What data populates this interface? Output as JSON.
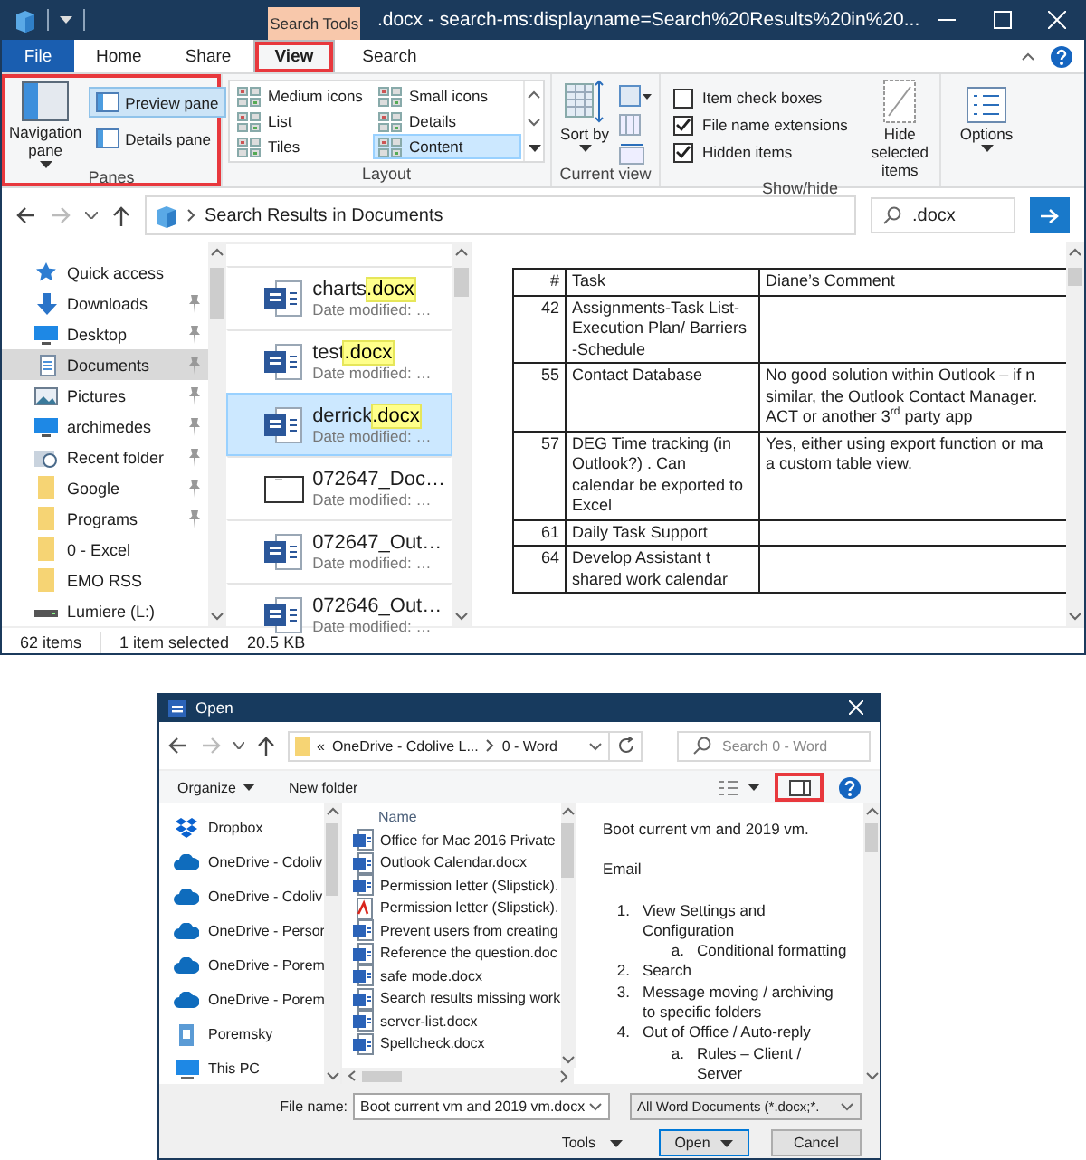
{
  "explorer": {
    "title": ".docx - search-ms:displayname=Search%20Results%20in%20...",
    "context_tab": "Search Tools",
    "tabs": [
      {
        "label": "File",
        "kind": "file",
        "selected": false,
        "highlighted": false
      },
      {
        "label": "Home",
        "kind": "plain",
        "selected": false,
        "highlighted": false
      },
      {
        "label": "Share",
        "kind": "plain",
        "selected": false,
        "highlighted": false
      },
      {
        "label": "View",
        "kind": "plain",
        "selected": true,
        "highlighted": true
      },
      {
        "label": "Search",
        "kind": "context",
        "selected": false,
        "highlighted": false
      }
    ],
    "ribbon": {
      "panes": {
        "label": "Panes",
        "highlighted": true,
        "navigation_pane": "Navigation pane",
        "buttons": [
          {
            "label": "Preview pane",
            "selected": true
          },
          {
            "label": "Details pane",
            "selected": false
          }
        ]
      },
      "layout": {
        "label": "Layout",
        "options": [
          {
            "label": "Medium icons",
            "selected": false
          },
          {
            "label": "Small icons",
            "selected": false
          },
          {
            "label": "List",
            "selected": false
          },
          {
            "label": "Details",
            "selected": false
          },
          {
            "label": "Tiles",
            "selected": false
          },
          {
            "label": "Content",
            "selected": true
          }
        ]
      },
      "current_view": {
        "label": "Current view",
        "sort_by": "Sort by"
      },
      "show_hide": {
        "label": "Show/hide",
        "checkboxes": [
          {
            "label": "Item check boxes",
            "checked": false
          },
          {
            "label": "File name extensions",
            "checked": true
          },
          {
            "label": "Hidden items",
            "checked": true
          }
        ],
        "hide_selected": "Hide selected items"
      },
      "options": "Options"
    },
    "address": "Search Results in Documents",
    "search_value": ".docx",
    "nav": [
      {
        "label": "Quick access",
        "kind": "star",
        "pinned": false,
        "selected": false
      },
      {
        "label": "Downloads",
        "kind": "download",
        "pinned": true,
        "selected": false
      },
      {
        "label": "Desktop",
        "kind": "monitor",
        "pinned": true,
        "selected": false
      },
      {
        "label": "Documents",
        "kind": "document",
        "pinned": true,
        "selected": true
      },
      {
        "label": "Pictures",
        "kind": "picture",
        "pinned": true,
        "selected": false
      },
      {
        "label": "archimedes",
        "kind": "monitor",
        "pinned": true,
        "selected": false
      },
      {
        "label": "Recent folder",
        "kind": "recent",
        "pinned": true,
        "selected": false
      },
      {
        "label": "Google",
        "kind": "folder",
        "pinned": true,
        "selected": false
      },
      {
        "label": "Programs",
        "kind": "folder",
        "pinned": true,
        "selected": false
      },
      {
        "label": "0 - Excel",
        "kind": "folder",
        "pinned": false,
        "selected": false
      },
      {
        "label": "EMO RSS",
        "kind": "folder",
        "pinned": false,
        "selected": false
      },
      {
        "label": "Lumiere (L:)",
        "kind": "drive",
        "pinned": false,
        "selected": false
      }
    ],
    "files": [
      {
        "name": "charts",
        "highlight": ".docx",
        "detail": "Date modified: …",
        "kind": "word",
        "selected": false
      },
      {
        "name": "test",
        "highlight": ".docx",
        "detail": "Date modified: …",
        "kind": "word",
        "selected": false
      },
      {
        "name": "derrick",
        "highlight": ".docx",
        "detail": "Date modified: …",
        "kind": "word",
        "selected": true
      },
      {
        "name": "072647_Doc…",
        "detail": "Date modified: …",
        "kind": "blank",
        "selected": false
      },
      {
        "name": "072647_Out…",
        "detail": "Date modified: …",
        "kind": "word",
        "selected": false
      },
      {
        "name": "072646_Out…",
        "detail": "Date modified: …",
        "kind": "word",
        "selected": false
      }
    ],
    "preview_table": {
      "columns": [
        "#",
        "Task",
        "Diane’s Comment"
      ],
      "rows": [
        {
          "num": "42",
          "task": "Assignments-Task List-Execution Plan/ Barriers -Schedule"
        },
        {
          "num": "55",
          "task": "Contact Database",
          "comment": [
            "No good solution within Outlook – if n",
            "similar, the Outlook Contact Manager.",
            "ACT or another 3$^{rd}$ party app"
          ]
        },
        {
          "num": "57",
          "task": "DEG Time tracking (in Outlook?) .  Can calendar be exported to Excel",
          "comment": [
            "Yes, either using export function or ma",
            "a custom table view."
          ]
        },
        {
          "num": "61",
          "task": "Daily Task Support"
        },
        {
          "num": "64",
          "task": "Develop Assistant t shared work calendar"
        }
      ]
    },
    "status": {
      "count": "62 items",
      "selection": "1 item selected",
      "size": "20.5 KB"
    }
  },
  "open_dialog": {
    "title": "Open",
    "address": {
      "overflow": "«",
      "crumbs": [
        "OneDrive - Cdolive L...",
        "0 - Word"
      ]
    },
    "search_placeholder": "Search 0 - Word",
    "toolbar": {
      "organize": "Organize",
      "new_folder": "New folder",
      "preview_highlighted": true
    },
    "nav": [
      {
        "label": "Dropbox",
        "kind": "dropbox"
      },
      {
        "label": "OneDrive - Cdoliv",
        "kind": "cloud"
      },
      {
        "label": "OneDrive - Cdoliv",
        "kind": "cloud"
      },
      {
        "label": "OneDrive - Persor",
        "kind": "cloud"
      },
      {
        "label": "OneDrive - Porem",
        "kind": "cloud"
      },
      {
        "label": "OneDrive - Porem",
        "kind": "cloud"
      },
      {
        "label": "Poremsky",
        "kind": "user"
      },
      {
        "label": "This PC",
        "kind": "pc"
      }
    ],
    "column": "Name",
    "files": [
      {
        "name": "Office for Mac 2016 Private",
        "kind": "word"
      },
      {
        "name": "Outlook Calendar.docx",
        "kind": "word"
      },
      {
        "name": "Permission letter (Slipstick).",
        "kind": "word"
      },
      {
        "name": "Permission letter (Slipstick).",
        "kind": "pdf"
      },
      {
        "name": "Prevent users from creating",
        "kind": "word"
      },
      {
        "name": "Reference the question.doc",
        "kind": "word"
      },
      {
        "name": "safe mode.docx",
        "kind": "word"
      },
      {
        "name": "Search results missing work",
        "kind": "word"
      },
      {
        "name": "server-list.docx",
        "kind": "word"
      },
      {
        "name": "Spellcheck.docx",
        "kind": "word"
      }
    ],
    "preview": [
      {
        "kind": "paragraph",
        "text": "Boot current vm and 2019 vm."
      },
      {
        "kind": "paragraph",
        "text": "Email"
      },
      {
        "kind": "item",
        "marker": "1.",
        "text": "View Settings and Configuration",
        "children": [
          {
            "kind": "item",
            "marker": "a.",
            "text": "Conditional formatting"
          }
        ]
      },
      {
        "kind": "item",
        "marker": "2.",
        "text": "Search"
      },
      {
        "kind": "item",
        "marker": "3.",
        "text": "Message moving / archiving to specific folders"
      },
      {
        "kind": "item",
        "marker": "4.",
        "text": "Out of Office / Auto-reply",
        "children": [
          {
            "kind": "item",
            "marker": "a.",
            "text": "Rules – Client / Server"
          }
        ]
      }
    ],
    "file_name_label": "File name:",
    "file_name": "Boot current vm and 2019 vm.docx",
    "filter": "All Word Documents (*.docx;*.",
    "tools": "Tools",
    "open": "Open",
    "cancel": "Cancel"
  }
}
